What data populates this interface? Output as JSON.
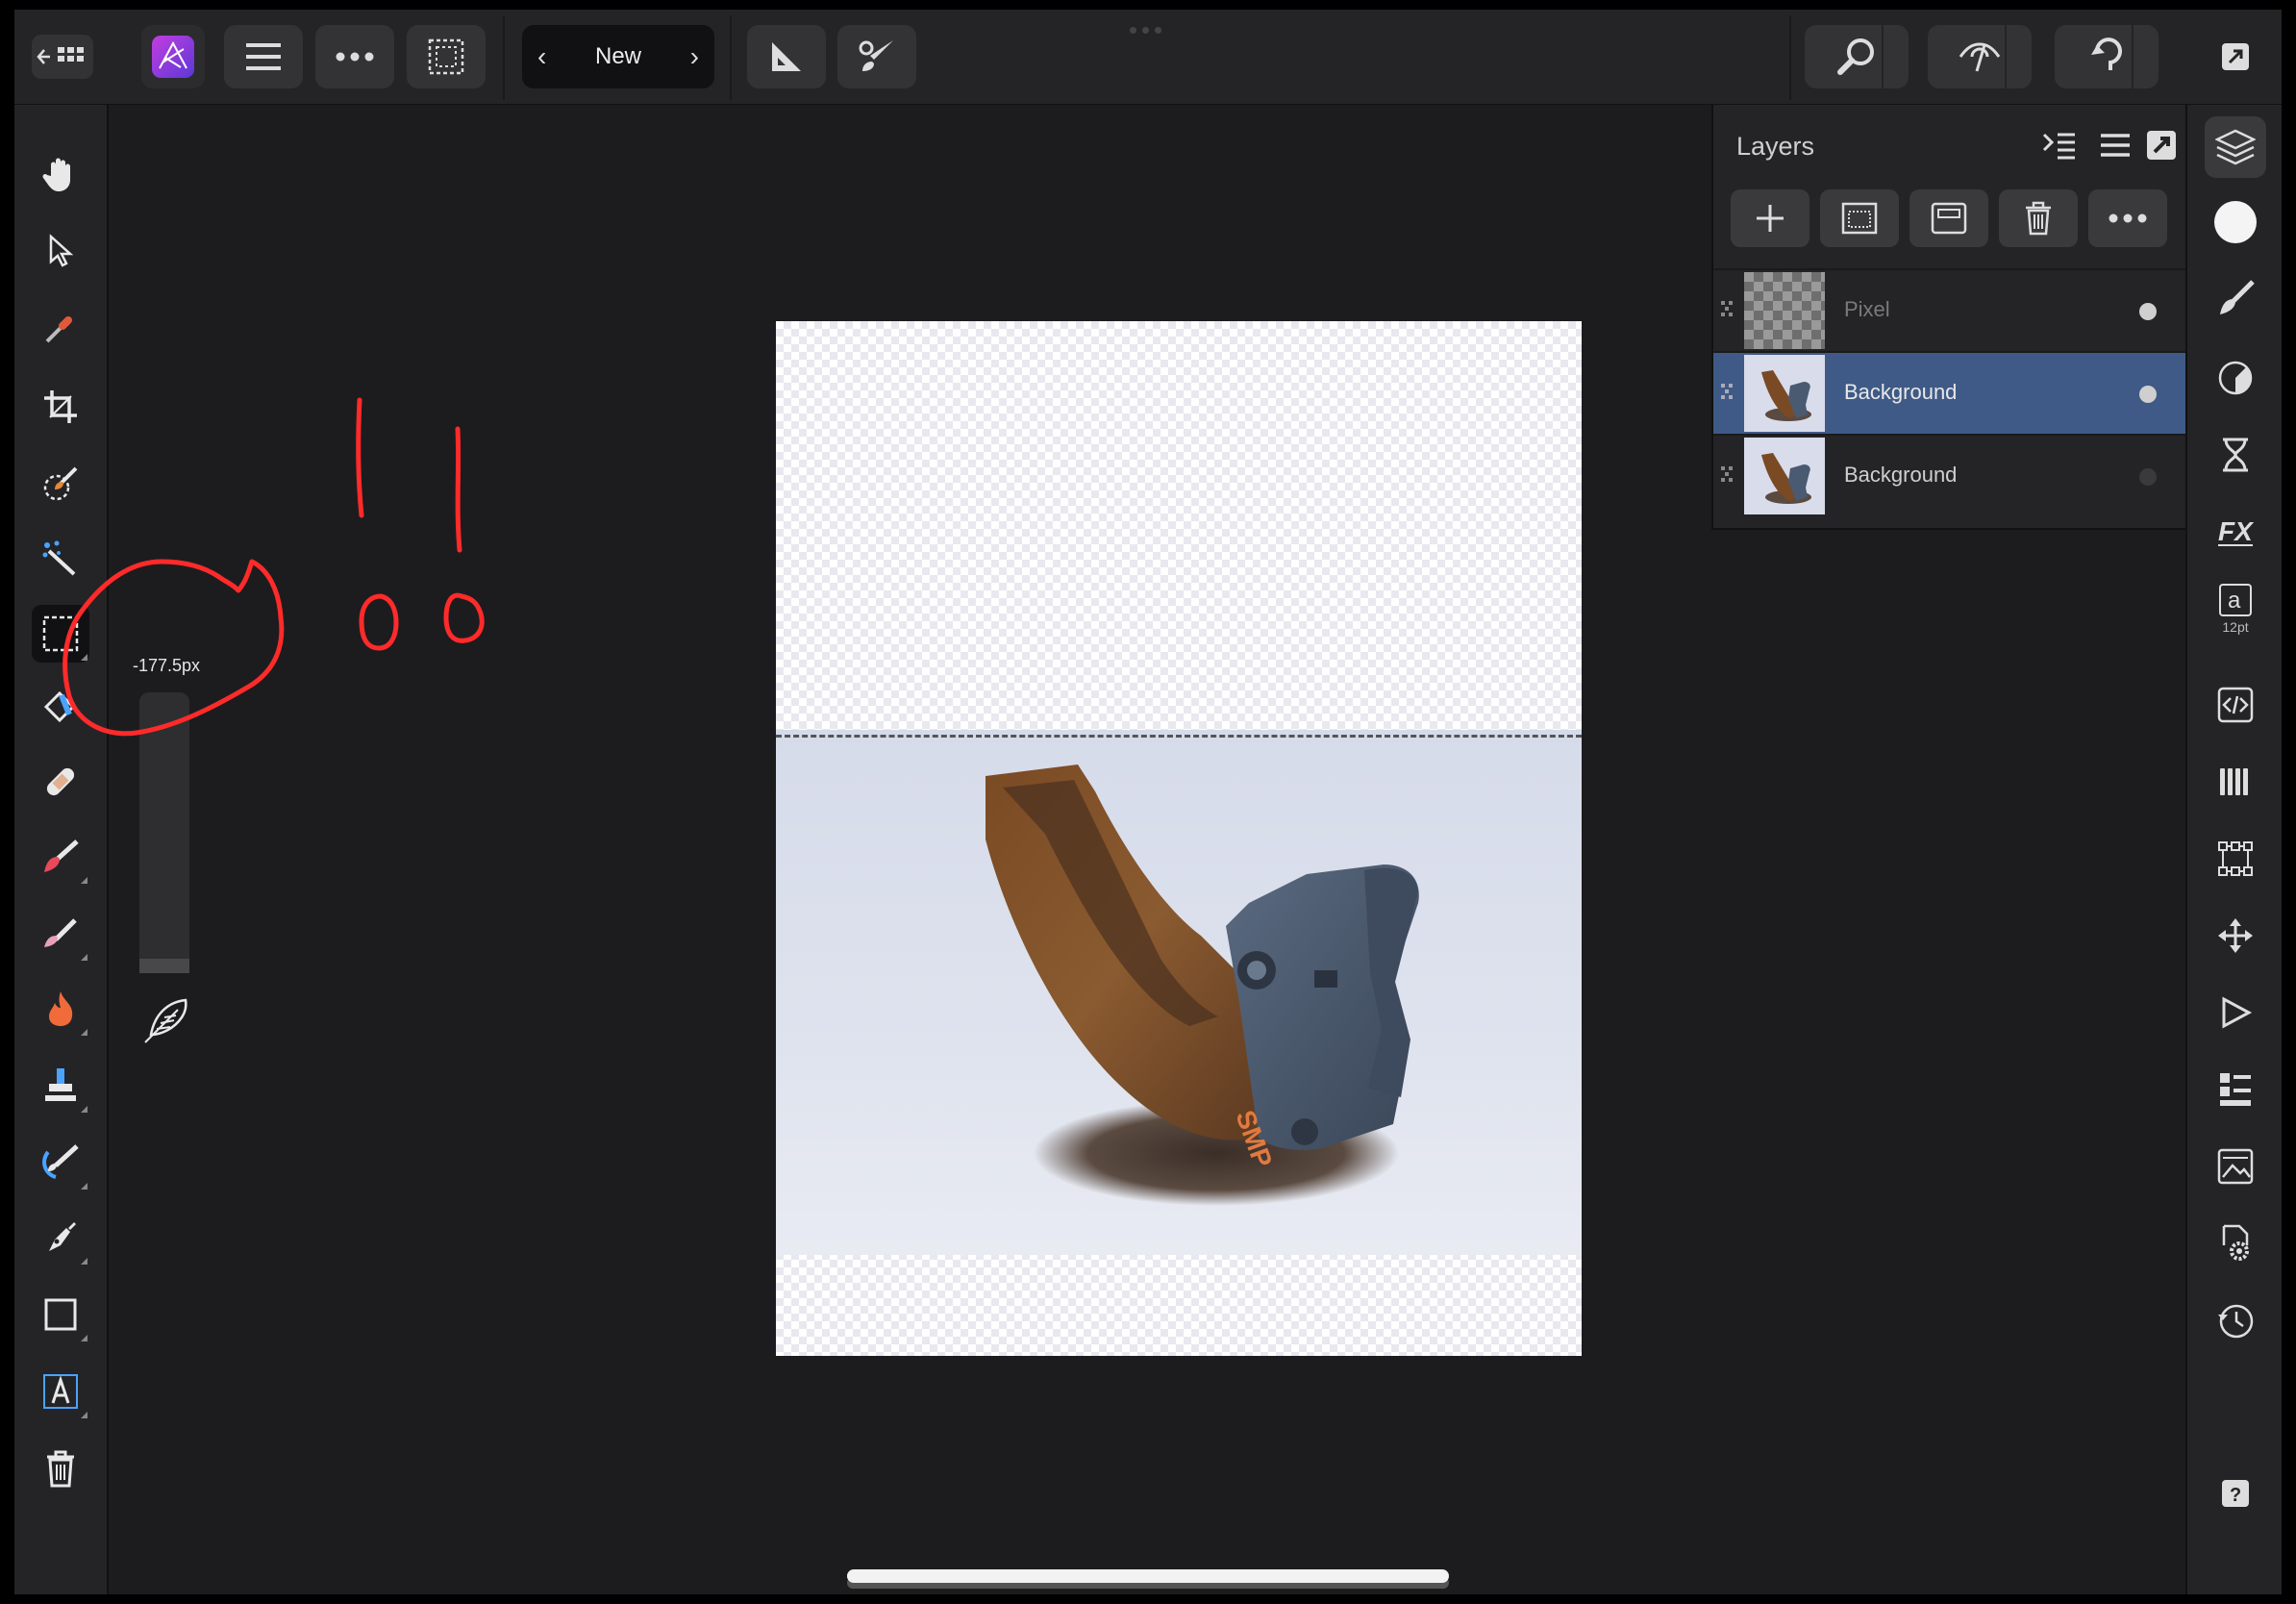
{
  "toolbar": {
    "document_name": "New",
    "prev_label": "‹",
    "next_label": "›"
  },
  "layers_panel": {
    "title": "Layers",
    "rows": [
      {
        "name": "Pixel",
        "visible": true,
        "selected": false,
        "dimmed": true
      },
      {
        "name": "Background",
        "visible": true,
        "selected": true,
        "dimmed": false
      },
      {
        "name": "Background",
        "visible": false,
        "selected": false,
        "dimmed": false
      }
    ]
  },
  "feather_popup": {
    "value_label": "-177.5px",
    "slider_fraction": 0.05
  },
  "text_style_tool": {
    "glyph": "a",
    "size_label": "12pt"
  },
  "help_label": "?",
  "left_tools": [
    "hand-icon",
    "move-icon",
    "color-picker-icon",
    "crop-icon",
    "selection-brush-icon",
    "flood-select-icon",
    "marquee-icon",
    "flood-fill-icon",
    "healing-icon",
    "paint-brush-icon",
    "erase-icon",
    "burn-icon",
    "clone-icon",
    "smudge-icon",
    "pen-icon",
    "rectangle-icon",
    "text-icon",
    "trash-icon"
  ],
  "right_studio": [
    "layers-icon",
    "color-icon",
    "brush-studio-icon",
    "adjustments-icon",
    "history-icon",
    "fx-icon",
    "text-styles-icon",
    "transform-icon",
    "channels-icon",
    "navigator-icon",
    "move-icon",
    "macro-icon",
    "stock-icon",
    "export-icon",
    "settings-icon",
    "history-clock-icon",
    "help-icon"
  ],
  "colors": {
    "accent_selected": "#3f5a86",
    "app_icon": "#8b3fd9",
    "annotation": "#ff2a2a"
  }
}
